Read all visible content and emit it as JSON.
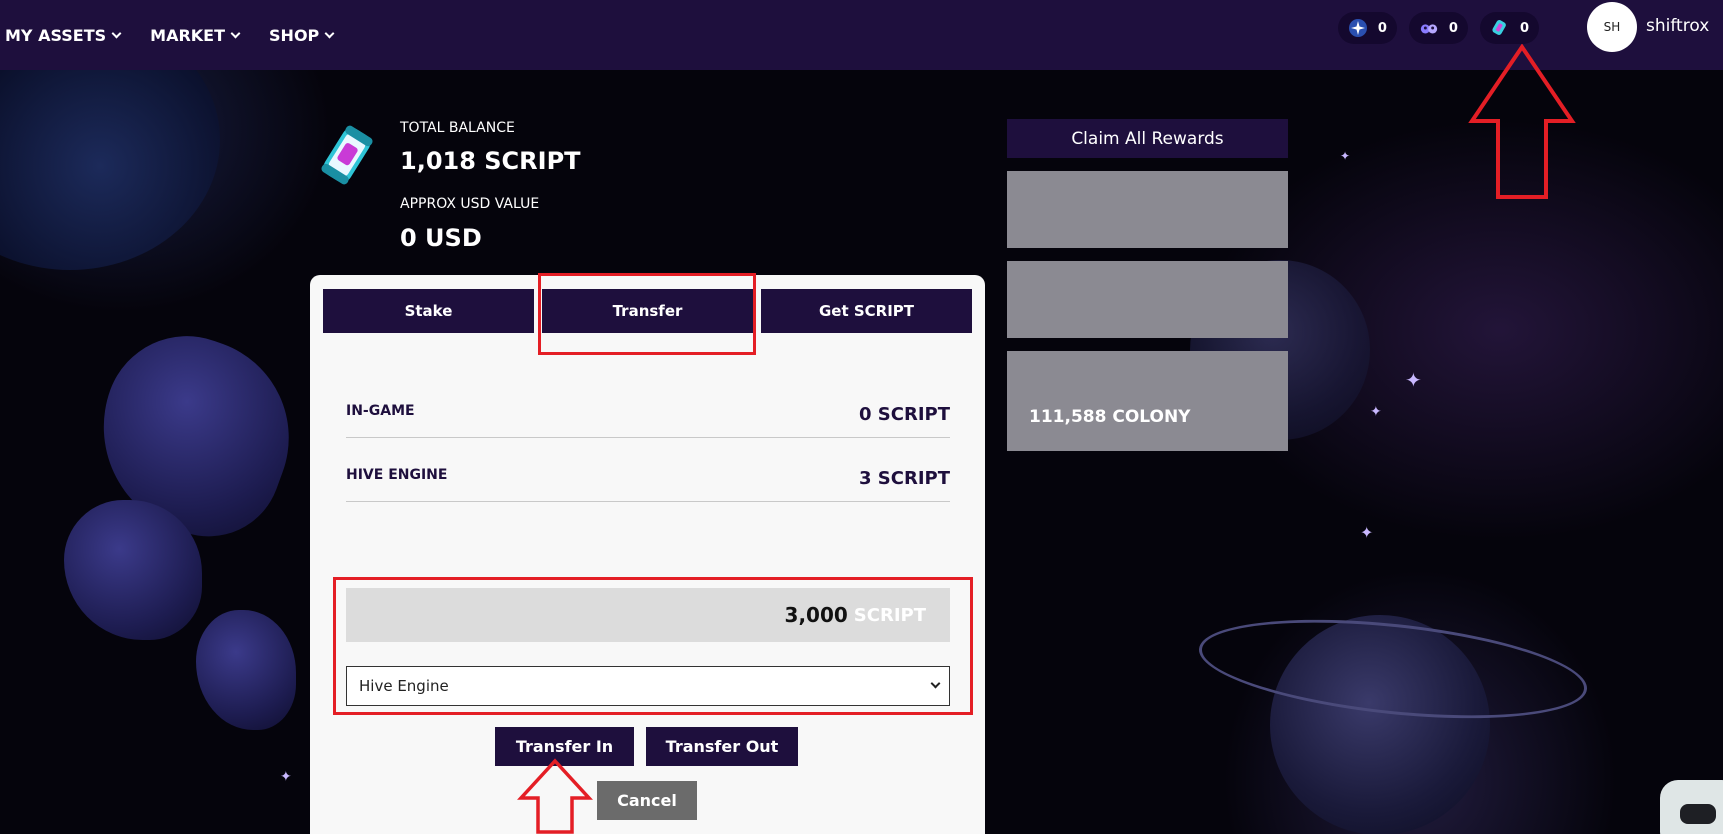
{
  "nav": {
    "items": [
      {
        "label": "MY ASSETS"
      },
      {
        "label": "MARKET"
      },
      {
        "label": "SHOP"
      }
    ]
  },
  "currencies": [
    {
      "icon": "compass-star-icon",
      "value": "0"
    },
    {
      "icon": "creature-icon",
      "value": "0"
    },
    {
      "icon": "script-token-icon",
      "value": "0"
    }
  ],
  "user": {
    "initials": "SH",
    "name": "shiftrox"
  },
  "balance": {
    "total_label": "TOTAL BALANCE",
    "total_value": "1,018 SCRIPT",
    "usd_label": "APPROX USD VALUE",
    "usd_value": "0 USD"
  },
  "tabs": [
    {
      "label": "Stake"
    },
    {
      "label": "Transfer"
    },
    {
      "label": "Get SCRIPT"
    }
  ],
  "rows": [
    {
      "label": "IN-GAME",
      "value": "0 SCRIPT"
    },
    {
      "label": "HIVE ENGINE",
      "value": "3 SCRIPT"
    }
  ],
  "transfer": {
    "amount": "3,000",
    "unit": "SCRIPT",
    "destination": "Hive Engine",
    "transfer_in_label": "Transfer In",
    "transfer_out_label": "Transfer Out",
    "cancel_label": "Cancel"
  },
  "rewards": {
    "claim_label": "Claim All Rewards",
    "staked_value": "111,588 COLONY"
  },
  "colors": {
    "header": "#1e0f3d",
    "button": "#1e0f3d",
    "annotation": "#e41e25"
  }
}
